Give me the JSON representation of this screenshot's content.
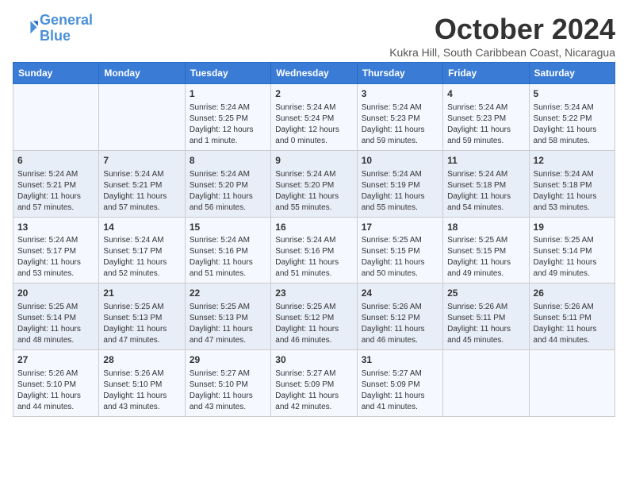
{
  "logo": {
    "line1": "General",
    "line2": "Blue"
  },
  "title": "October 2024",
  "subtitle": "Kukra Hill, South Caribbean Coast, Nicaragua",
  "headers": [
    "Sunday",
    "Monday",
    "Tuesday",
    "Wednesday",
    "Thursday",
    "Friday",
    "Saturday"
  ],
  "weeks": [
    [
      {
        "day": "",
        "info": ""
      },
      {
        "day": "",
        "info": ""
      },
      {
        "day": "1",
        "info": "Sunrise: 5:24 AM\nSunset: 5:25 PM\nDaylight: 12 hours\nand 1 minute."
      },
      {
        "day": "2",
        "info": "Sunrise: 5:24 AM\nSunset: 5:24 PM\nDaylight: 12 hours\nand 0 minutes."
      },
      {
        "day": "3",
        "info": "Sunrise: 5:24 AM\nSunset: 5:23 PM\nDaylight: 11 hours\nand 59 minutes."
      },
      {
        "day": "4",
        "info": "Sunrise: 5:24 AM\nSunset: 5:23 PM\nDaylight: 11 hours\nand 59 minutes."
      },
      {
        "day": "5",
        "info": "Sunrise: 5:24 AM\nSunset: 5:22 PM\nDaylight: 11 hours\nand 58 minutes."
      }
    ],
    [
      {
        "day": "6",
        "info": "Sunrise: 5:24 AM\nSunset: 5:21 PM\nDaylight: 11 hours\nand 57 minutes."
      },
      {
        "day": "7",
        "info": "Sunrise: 5:24 AM\nSunset: 5:21 PM\nDaylight: 11 hours\nand 57 minutes."
      },
      {
        "day": "8",
        "info": "Sunrise: 5:24 AM\nSunset: 5:20 PM\nDaylight: 11 hours\nand 56 minutes."
      },
      {
        "day": "9",
        "info": "Sunrise: 5:24 AM\nSunset: 5:20 PM\nDaylight: 11 hours\nand 55 minutes."
      },
      {
        "day": "10",
        "info": "Sunrise: 5:24 AM\nSunset: 5:19 PM\nDaylight: 11 hours\nand 55 minutes."
      },
      {
        "day": "11",
        "info": "Sunrise: 5:24 AM\nSunset: 5:18 PM\nDaylight: 11 hours\nand 54 minutes."
      },
      {
        "day": "12",
        "info": "Sunrise: 5:24 AM\nSunset: 5:18 PM\nDaylight: 11 hours\nand 53 minutes."
      }
    ],
    [
      {
        "day": "13",
        "info": "Sunrise: 5:24 AM\nSunset: 5:17 PM\nDaylight: 11 hours\nand 53 minutes."
      },
      {
        "day": "14",
        "info": "Sunrise: 5:24 AM\nSunset: 5:17 PM\nDaylight: 11 hours\nand 52 minutes."
      },
      {
        "day": "15",
        "info": "Sunrise: 5:24 AM\nSunset: 5:16 PM\nDaylight: 11 hours\nand 51 minutes."
      },
      {
        "day": "16",
        "info": "Sunrise: 5:24 AM\nSunset: 5:16 PM\nDaylight: 11 hours\nand 51 minutes."
      },
      {
        "day": "17",
        "info": "Sunrise: 5:25 AM\nSunset: 5:15 PM\nDaylight: 11 hours\nand 50 minutes."
      },
      {
        "day": "18",
        "info": "Sunrise: 5:25 AM\nSunset: 5:15 PM\nDaylight: 11 hours\nand 49 minutes."
      },
      {
        "day": "19",
        "info": "Sunrise: 5:25 AM\nSunset: 5:14 PM\nDaylight: 11 hours\nand 49 minutes."
      }
    ],
    [
      {
        "day": "20",
        "info": "Sunrise: 5:25 AM\nSunset: 5:14 PM\nDaylight: 11 hours\nand 48 minutes."
      },
      {
        "day": "21",
        "info": "Sunrise: 5:25 AM\nSunset: 5:13 PM\nDaylight: 11 hours\nand 47 minutes."
      },
      {
        "day": "22",
        "info": "Sunrise: 5:25 AM\nSunset: 5:13 PM\nDaylight: 11 hours\nand 47 minutes."
      },
      {
        "day": "23",
        "info": "Sunrise: 5:25 AM\nSunset: 5:12 PM\nDaylight: 11 hours\nand 46 minutes."
      },
      {
        "day": "24",
        "info": "Sunrise: 5:26 AM\nSunset: 5:12 PM\nDaylight: 11 hours\nand 46 minutes."
      },
      {
        "day": "25",
        "info": "Sunrise: 5:26 AM\nSunset: 5:11 PM\nDaylight: 11 hours\nand 45 minutes."
      },
      {
        "day": "26",
        "info": "Sunrise: 5:26 AM\nSunset: 5:11 PM\nDaylight: 11 hours\nand 44 minutes."
      }
    ],
    [
      {
        "day": "27",
        "info": "Sunrise: 5:26 AM\nSunset: 5:10 PM\nDaylight: 11 hours\nand 44 minutes."
      },
      {
        "day": "28",
        "info": "Sunrise: 5:26 AM\nSunset: 5:10 PM\nDaylight: 11 hours\nand 43 minutes."
      },
      {
        "day": "29",
        "info": "Sunrise: 5:27 AM\nSunset: 5:10 PM\nDaylight: 11 hours\nand 43 minutes."
      },
      {
        "day": "30",
        "info": "Sunrise: 5:27 AM\nSunset: 5:09 PM\nDaylight: 11 hours\nand 42 minutes."
      },
      {
        "day": "31",
        "info": "Sunrise: 5:27 AM\nSunset: 5:09 PM\nDaylight: 11 hours\nand 41 minutes."
      },
      {
        "day": "",
        "info": ""
      },
      {
        "day": "",
        "info": ""
      }
    ]
  ]
}
